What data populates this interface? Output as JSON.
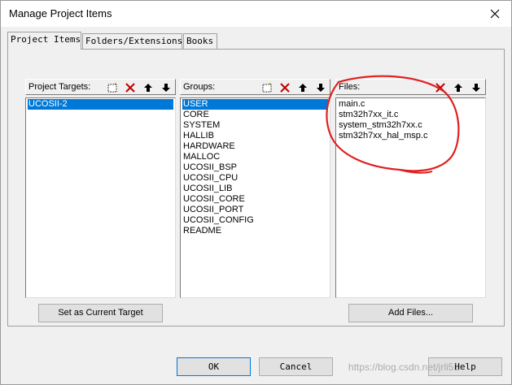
{
  "window": {
    "title": "Manage Project Items"
  },
  "tabs": [
    {
      "label": "Project Items",
      "active": true
    },
    {
      "label": "Folders/Extensions",
      "active": false
    },
    {
      "label": "Books",
      "active": false
    }
  ],
  "targets": {
    "label": "Project Targets:",
    "items": [
      "UCOSII-2"
    ],
    "selected": 0
  },
  "groups": {
    "label": "Groups:",
    "items": [
      "USER",
      "CORE",
      "SYSTEM",
      "HALLIB",
      "HARDWARE",
      "MALLOC",
      "UCOSII_BSP",
      "UCOSII_CPU",
      "UCOSII_LIB",
      "UCOSII_CORE",
      "UCOSII_PORT",
      "UCOSII_CONFIG",
      "README"
    ],
    "selected": 0
  },
  "files": {
    "label": "Files:",
    "items": [
      "main.c",
      "stm32h7xx_it.c",
      "system_stm32h7xx.c",
      "stm32h7xx_hal_msp.c"
    ]
  },
  "buttons": {
    "set_current_target": "Set as Current Target",
    "add_files": "Add Files...",
    "ok": "OK",
    "cancel": "Cancel",
    "help": "Help"
  },
  "watermark": "https://blog.csdn.net/jrli51",
  "icons": {
    "new": "new-item-icon",
    "delete": "delete-icon",
    "move_up": "arrow-up-icon",
    "move_down": "arrow-down-icon"
  },
  "colors": {
    "selection": "#0078d7",
    "delete_red": "#c00000",
    "annotation_red": "#e02020"
  }
}
